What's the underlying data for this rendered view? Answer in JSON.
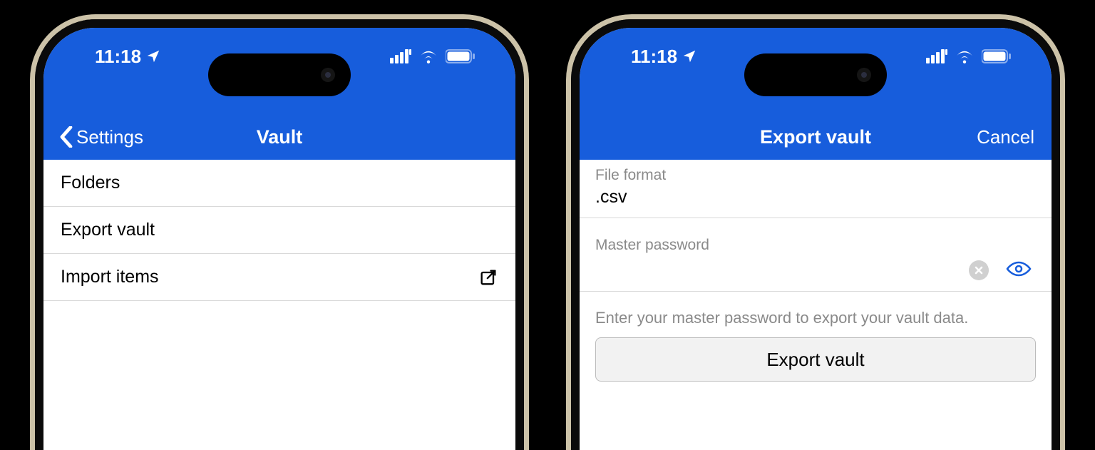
{
  "status": {
    "time": "11:18",
    "location_icon": "location-arrow"
  },
  "screen1": {
    "back_label": "Settings",
    "title": "Vault",
    "rows": [
      {
        "label": "Folders"
      },
      {
        "label": "Export vault"
      },
      {
        "label": "Import items",
        "external": true
      }
    ]
  },
  "screen2": {
    "title": "Export vault",
    "cancel_label": "Cancel",
    "file_format_label": "File format",
    "file_format_value": ".csv",
    "master_password_label": "Master password",
    "master_password_value": "",
    "helper_text": "Enter your master password to export your vault data.",
    "export_button_label": "Export vault"
  }
}
